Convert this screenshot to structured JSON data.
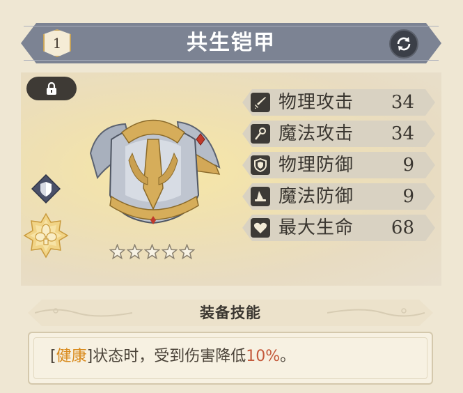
{
  "header": {
    "level": "1",
    "title": "共生铠甲",
    "refresh_icon": "refresh-icon"
  },
  "item": {
    "lock_icon": "lock-icon",
    "type_badge_icon": "shield-badge-icon",
    "set_badge_icon": "flower-badge-icon",
    "rarity_stars": 5
  },
  "stats": [
    {
      "icon": "sword-icon",
      "label": "物理攻击",
      "value": "34"
    },
    {
      "icon": "wand-icon",
      "label": "魔法攻击",
      "value": "34"
    },
    {
      "icon": "shield-icon",
      "label": "物理防御",
      "value": "9"
    },
    {
      "icon": "wizard-hat-icon",
      "label": "魔法防御",
      "value": "9"
    },
    {
      "icon": "heart-icon",
      "label": "最大生命",
      "value": "68"
    }
  ],
  "skills": {
    "title": "装备技能",
    "bracket_open": "[",
    "keyword": "健康",
    "bracket_close": "]",
    "text_mid": "状态时，受到伤害降低",
    "percent": "10%",
    "text_end": "。"
  },
  "colors": {
    "banner": "#7c8393",
    "highlight_keyword": "#d98a1c",
    "highlight_value": "#c45a3c"
  }
}
